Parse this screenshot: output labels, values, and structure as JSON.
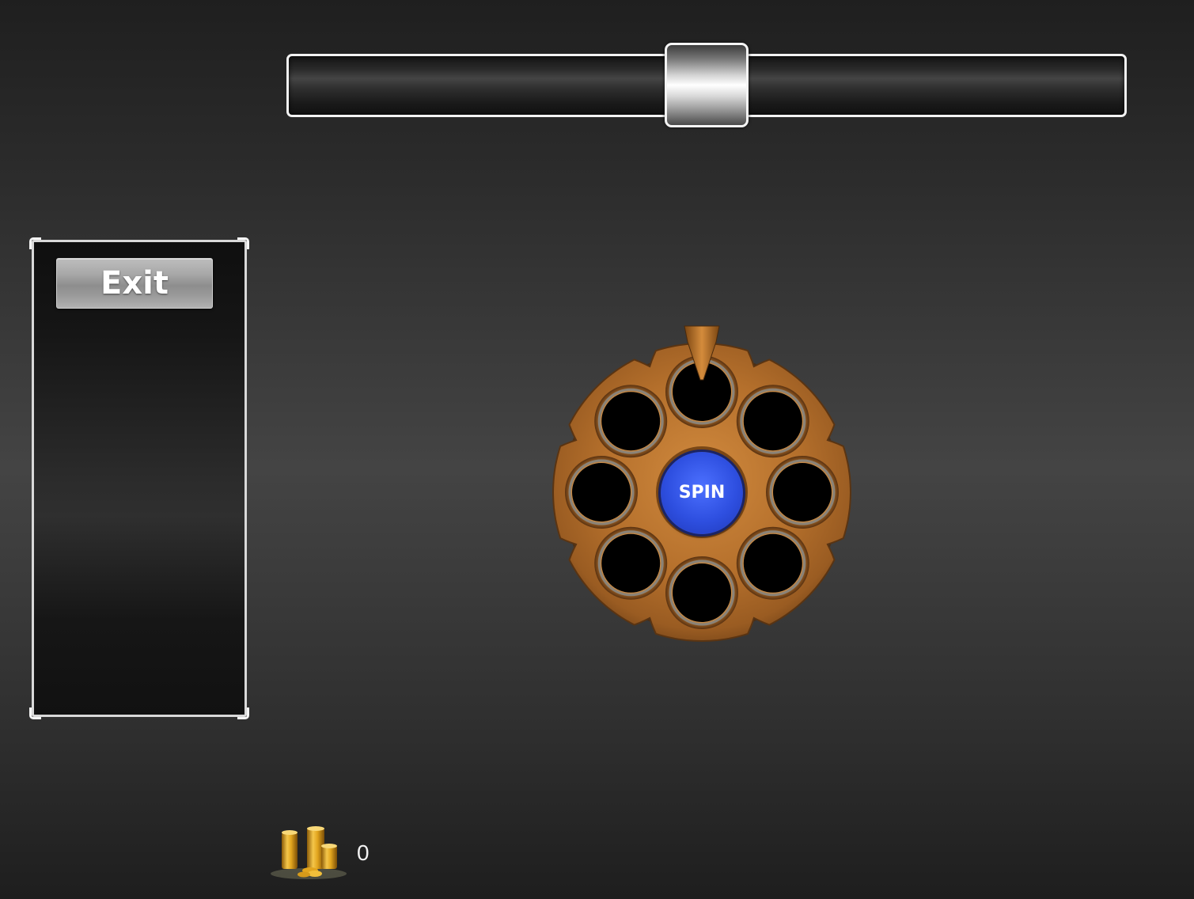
{
  "slider": {
    "value_fraction": 0.5
  },
  "side_panel": {
    "exit_label": "Exit"
  },
  "revolver": {
    "chambers": 8,
    "spin_label": "SPIN",
    "colors": {
      "brass": "#b5702c",
      "brass_dark": "#6e4016",
      "chamber": "#000000",
      "spin_button": "#2e4fe0"
    }
  },
  "coins": {
    "icon": "coin-stack-icon",
    "count": "0"
  }
}
